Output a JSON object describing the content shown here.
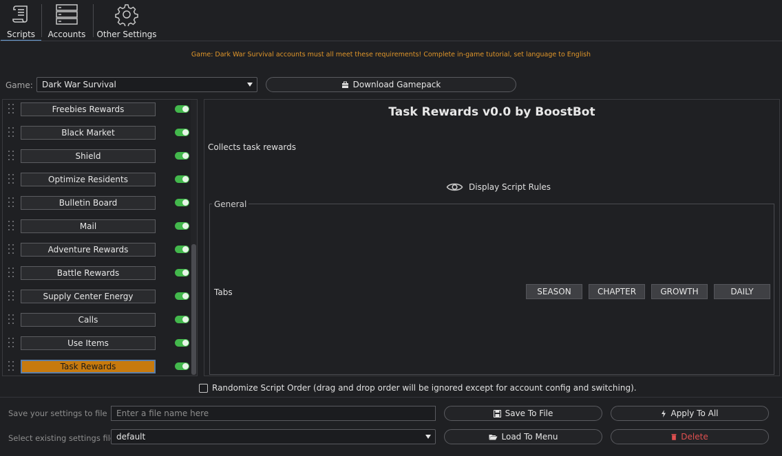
{
  "toolbar": {
    "tabs": [
      {
        "label": "Scripts",
        "icon": "scroll-icon",
        "active": true
      },
      {
        "label": "Accounts",
        "icon": "server-icon"
      },
      {
        "label": "Other Settings",
        "icon": "gear-icon"
      }
    ]
  },
  "notice": "Game: Dark War Survival accounts must all meet these requirements! Complete in-game tutorial, set language to English",
  "game": {
    "label": "Game:",
    "selected": "Dark War Survival",
    "download_label": "Download Gamepack"
  },
  "scripts": [
    {
      "label": "Freebies Rewards",
      "enabled": true
    },
    {
      "label": "Black Market",
      "enabled": true
    },
    {
      "label": "Shield",
      "enabled": true
    },
    {
      "label": "Optimize Residents",
      "enabled": true
    },
    {
      "label": "Bulletin Board",
      "enabled": true
    },
    {
      "label": "Mail",
      "enabled": true
    },
    {
      "label": "Adventure Rewards",
      "enabled": true
    },
    {
      "label": "Battle Rewards",
      "enabled": true
    },
    {
      "label": "Supply Center Energy",
      "enabled": true
    },
    {
      "label": "Calls",
      "enabled": true
    },
    {
      "label": "Use Items",
      "enabled": true
    },
    {
      "label": "Task Rewards",
      "enabled": true,
      "active": true
    }
  ],
  "detail": {
    "title": "Task Rewards v0.0 by BoostBot",
    "description": "Collects task rewards",
    "rules_label": "Display Script Rules",
    "group_title": "General",
    "tabs_label": "Tabs",
    "tabs": [
      "SEASON",
      "CHAPTER",
      "GROWTH",
      "DAILY"
    ]
  },
  "randomize_label": "Randomize Script Order (drag and drop order will be ignored except for account config and switching).",
  "save": {
    "label": "Save your settings to file",
    "placeholder": "Enter a file name here",
    "save_button": "Save To File",
    "apply_button": "Apply To All"
  },
  "load": {
    "label": "Select existing settings file",
    "selected": "default",
    "load_button": "Load To Menu",
    "delete_button": "Delete"
  },
  "colors": {
    "accent": "#c77a0e",
    "toggle_on": "#43b84c",
    "notice": "#e0962a",
    "delete": "#e05050"
  }
}
